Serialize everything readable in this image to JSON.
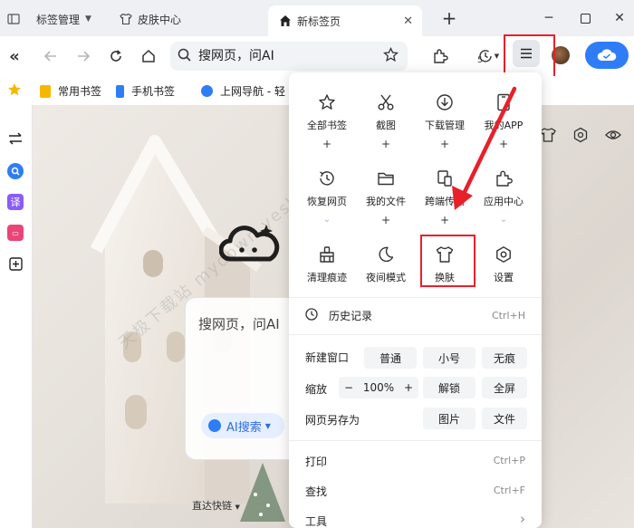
{
  "tabs": {
    "tab_manager": "标签管理",
    "skin_center": "皮肤中心",
    "new_tab": "新标签页"
  },
  "toolbar": {
    "search_placeholder": "搜网页，问AI",
    "history_count": "5"
  },
  "bookmarks": {
    "items": [
      "常用书签",
      "手机书签",
      "上网导航 - 轻"
    ]
  },
  "newtab": {
    "search_placeholder": "搜网页，问AI",
    "ai_search": "AI搜索",
    "quick_access": "直达快链",
    "watermark": "天极下载站 mydown.yesky.com"
  },
  "menu": {
    "grid": [
      {
        "label": "全部书签",
        "action": "+"
      },
      {
        "label": "截图",
        "action": "+"
      },
      {
        "label": "下载管理",
        "action": "+"
      },
      {
        "label": "我的APP",
        "action": "+"
      },
      {
        "label": "恢复网页",
        "action": "⌄"
      },
      {
        "label": "我的文件",
        "action": "+"
      },
      {
        "label": "跨端传输",
        "action": "+"
      },
      {
        "label": "应用中心",
        "action": "⌄"
      },
      {
        "label": "清理痕迹",
        "action": ""
      },
      {
        "label": "夜间模式",
        "action": ""
      },
      {
        "label": "换肤",
        "action": ""
      },
      {
        "label": "设置",
        "action": ""
      }
    ],
    "history": {
      "label": "历史记录",
      "shortcut": "Ctrl+H"
    },
    "new_window": {
      "label": "新建窗口",
      "options": [
        "普通",
        "小号",
        "无痕"
      ]
    },
    "zoom": {
      "label": "缩放",
      "minus": "−",
      "value": "100%",
      "plus": "+",
      "unlock": "解锁",
      "fullscreen": "全屏"
    },
    "save_as": {
      "label": "网页另存为",
      "options": [
        "图片",
        "文件"
      ]
    },
    "print": {
      "label": "打印",
      "shortcut": "Ctrl+P"
    },
    "find": {
      "label": "查找",
      "shortcut": "Ctrl+F"
    },
    "tools": {
      "label": "工具",
      "shortcut": "›"
    }
  },
  "colors": {
    "accent": "#2f7df6",
    "highlight": "#e8202a"
  }
}
